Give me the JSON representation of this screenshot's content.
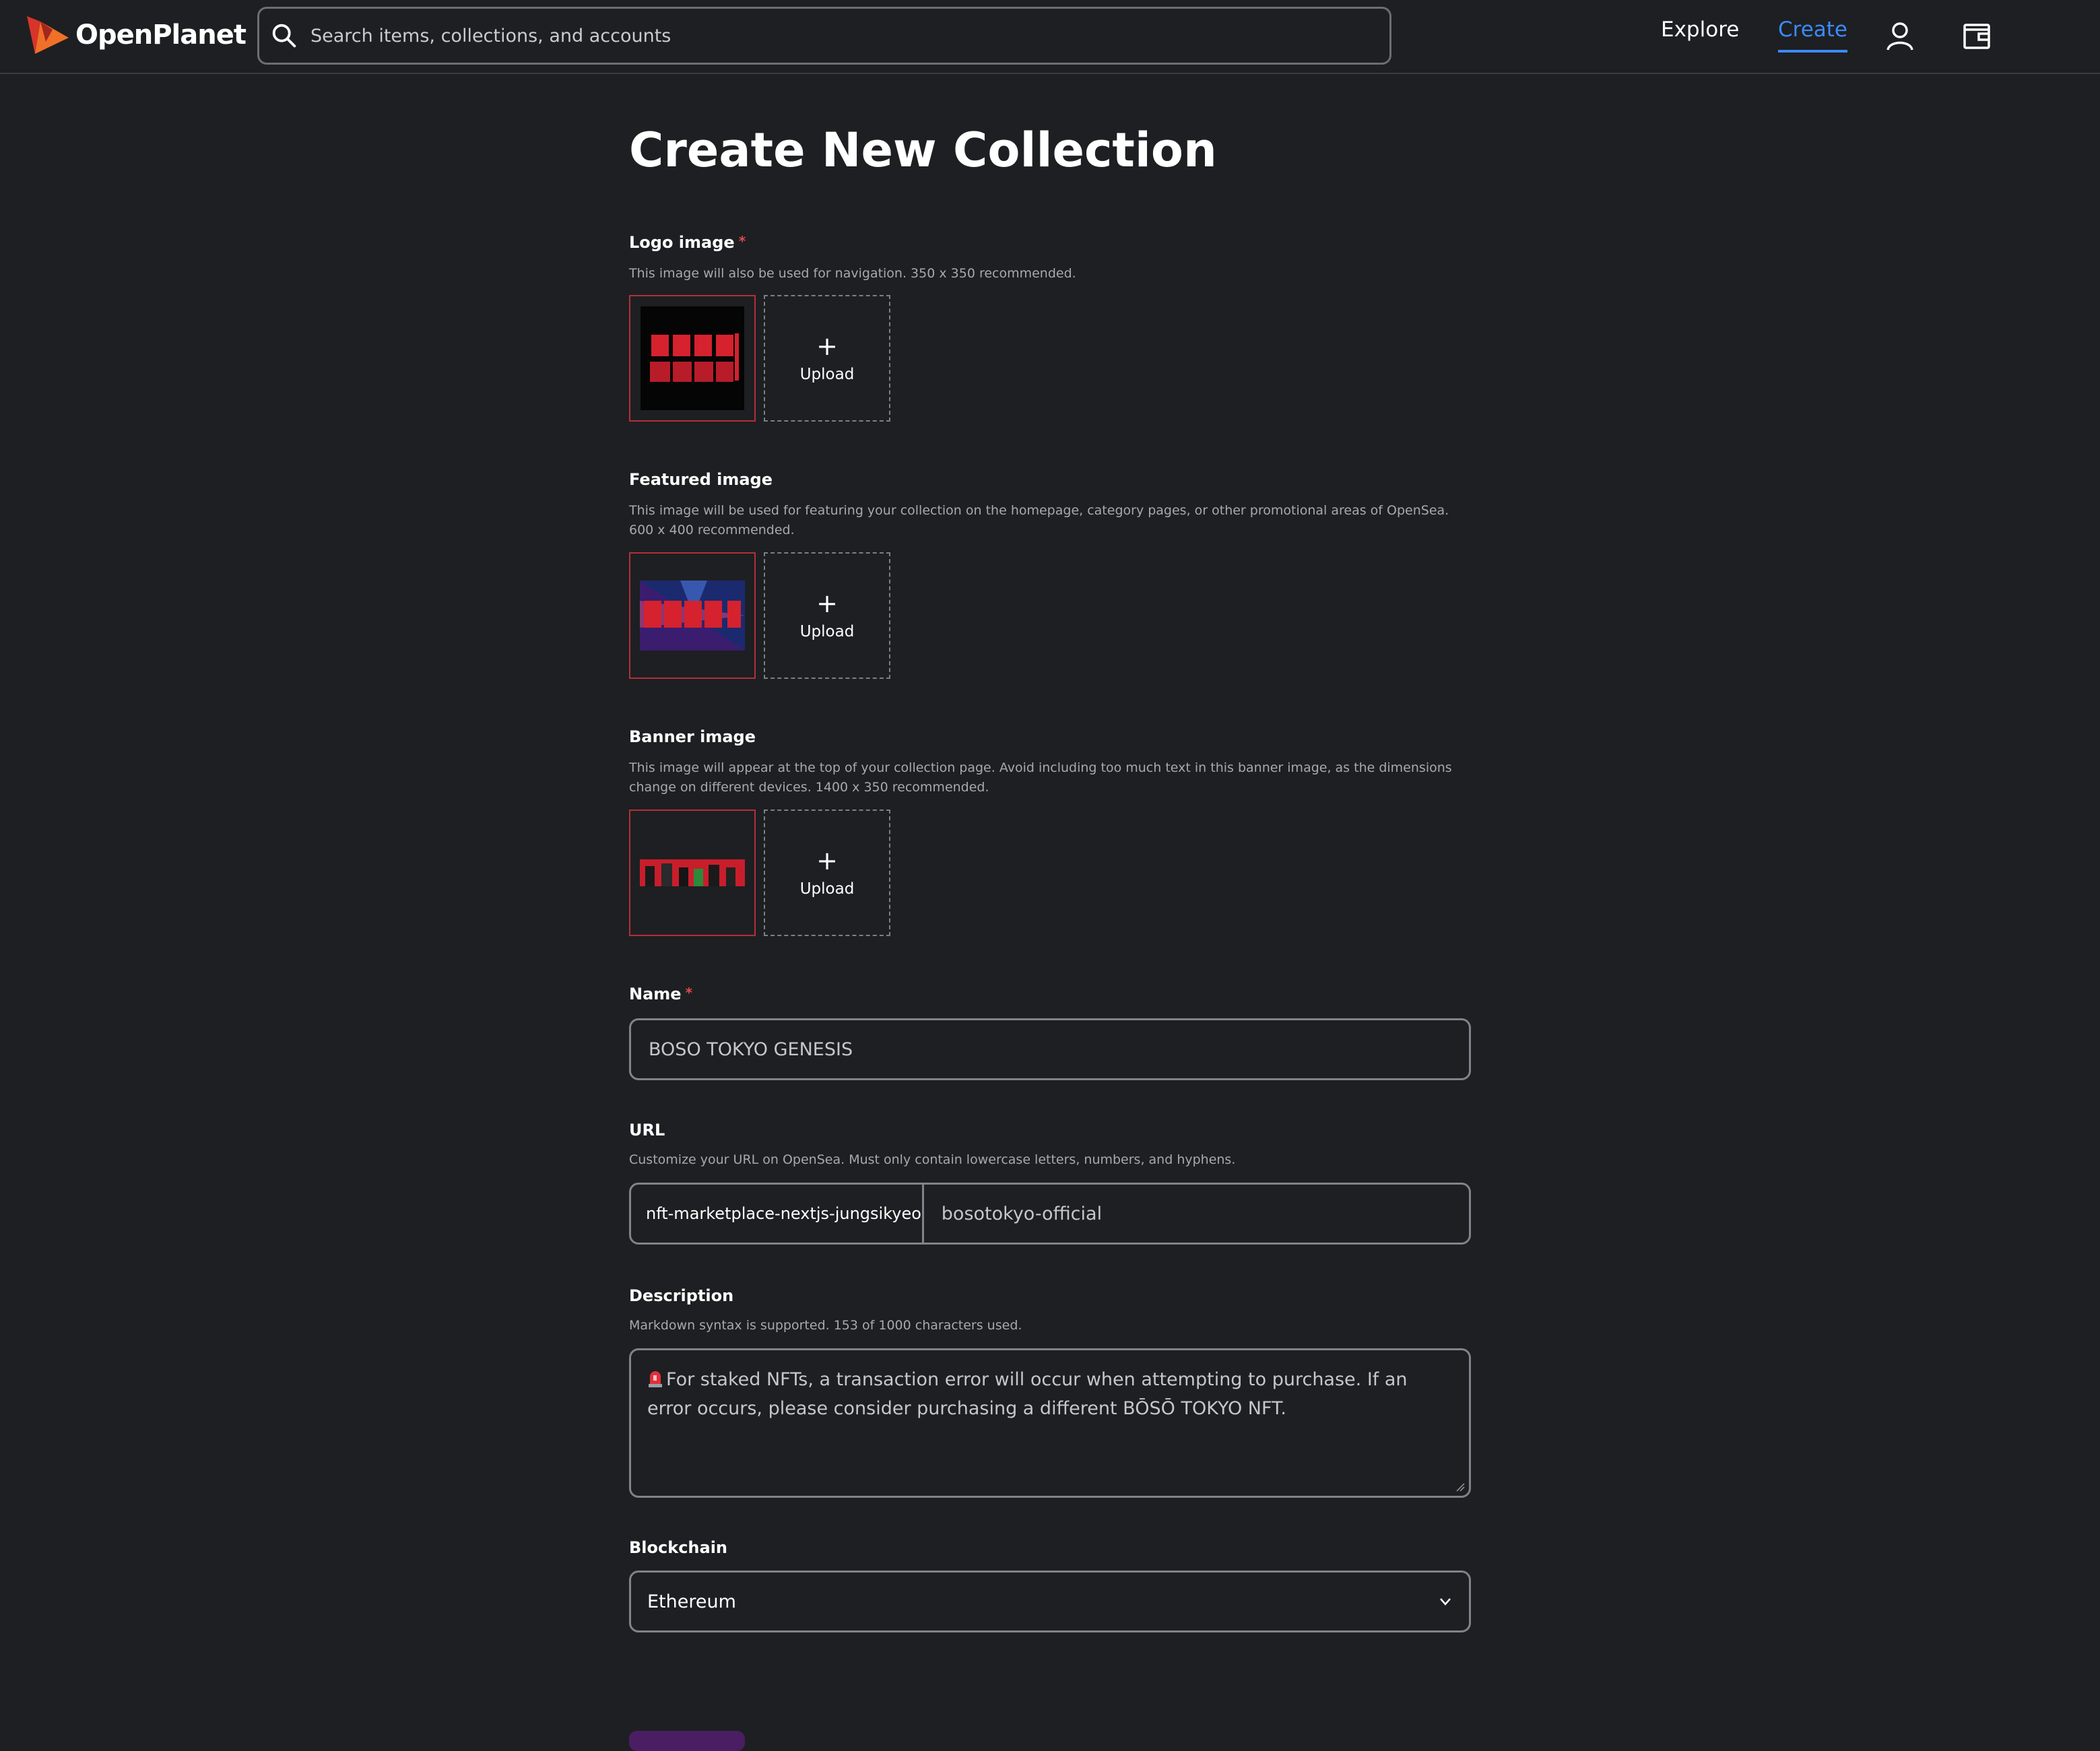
{
  "header": {
    "brand": "OpenPlanet",
    "search_placeholder": "Search items, collections, and accounts",
    "nav": {
      "explore": "Explore",
      "create": "Create"
    },
    "icons": [
      "search-icon",
      "profile-icon",
      "wallet-icon"
    ],
    "accent_color": "#3a8bff"
  },
  "page": {
    "title": "Create New Collection"
  },
  "logo": {
    "label": "Logo image",
    "required": "*",
    "hint": "This image will also be used for navigation. 350 x 350 recommended.",
    "upload_label": "Upload"
  },
  "featured": {
    "label": "Featured image",
    "hint": "This image will be used for featuring your collection on the homepage, category pages, or other promotional areas of OpenSea. 600 x 400 recommended.",
    "upload_label": "Upload"
  },
  "banner": {
    "label": "Banner image",
    "hint": "This image will appear at the top of your collection page. Avoid including too much text in this banner image, as the dimensions change on different devices. 1400 x 350 recommended.",
    "upload_label": "Upload"
  },
  "name": {
    "label": "Name",
    "required": "*",
    "value": "BOSO TOKYO GENESIS"
  },
  "url": {
    "label": "URL",
    "hint": "Customize your URL on OpenSea. Must only contain lowercase letters, numbers, and hyphens.",
    "prefix": "nft-marketplace-nextjs-jungsikyeo.vercel.app/collection/",
    "slug": "bosotokyo-official"
  },
  "description": {
    "label": "Description",
    "hint": "Markdown syntax is supported. 153 of 1000 characters used.",
    "value": "For staked NFTs, a transaction error will occur when attempting to purchase. If an error occurs, please consider purchasing a different BŌSŌ TOKYO NFT."
  },
  "blockchain": {
    "label": "Blockchain",
    "value": "Ethereum"
  }
}
